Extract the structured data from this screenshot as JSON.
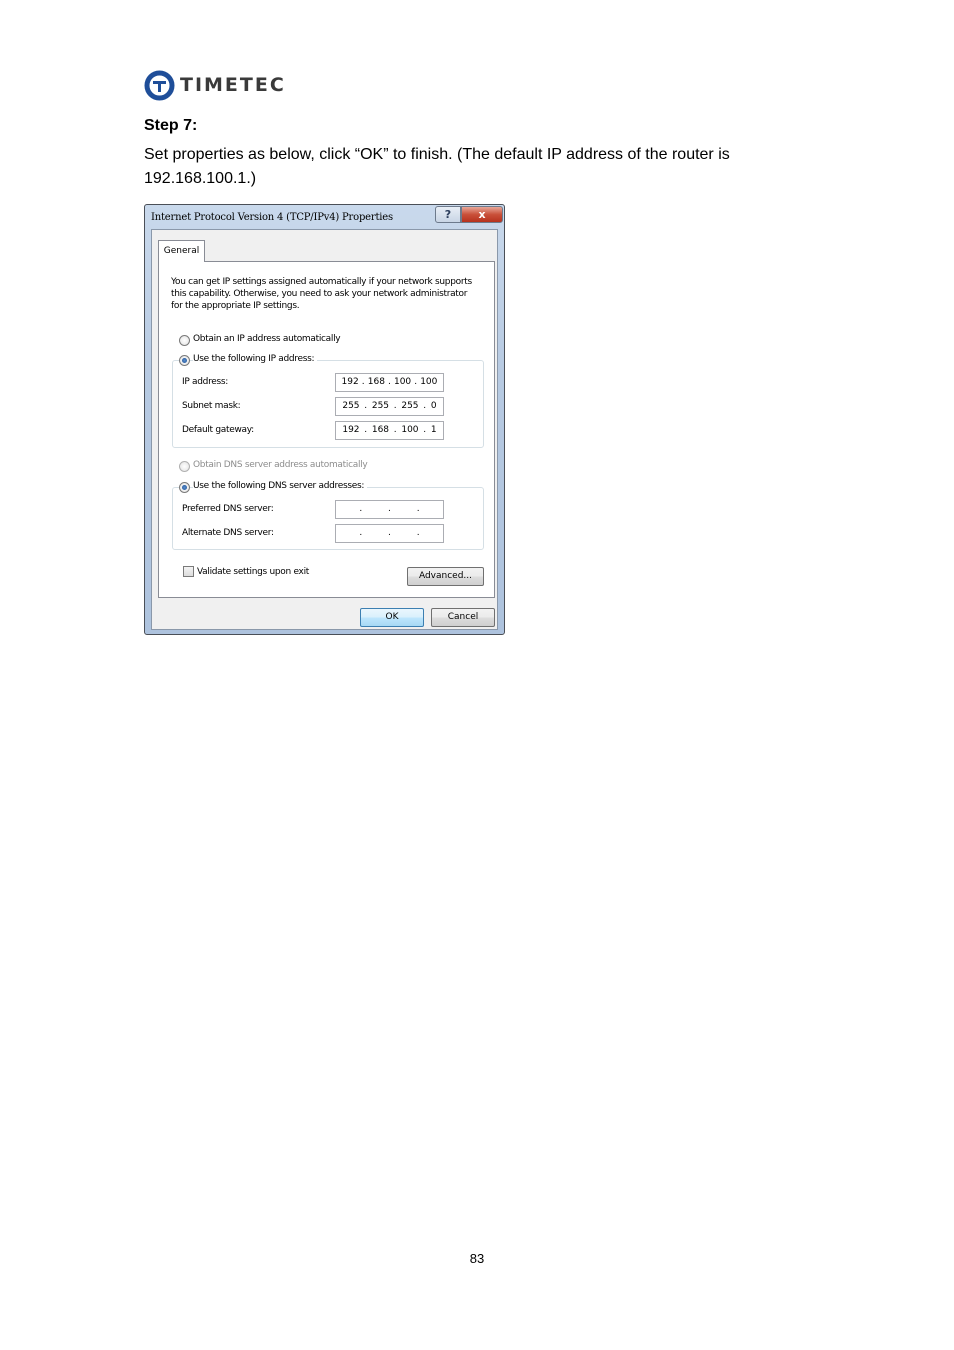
{
  "header": {
    "logo_text": "TIMETEC",
    "step_title": "Step 7:",
    "instruction": "Set properties as below, click “OK” to finish. (The default IP address of the router is 192.168.100.1.)"
  },
  "dialog": {
    "title": "Internet Protocol Version 4 (TCP/IPv4) Properties",
    "help_icon": "?",
    "close_icon": "x",
    "tab_general": "General",
    "intro": "You can get IP settings assigned automatically if your network supports this capability. Otherwise, you need to ask your network administrator for the appropriate IP settings.",
    "radio_auto_ip": "Obtain an IP address automatically",
    "radio_manual_ip": "Use the following IP address:",
    "ip_label": "IP address:",
    "ip_value": [
      "192",
      "168",
      "100",
      "100"
    ],
    "subnet_label": "Subnet mask:",
    "subnet_value": [
      "255",
      "255",
      "255",
      "0"
    ],
    "gateway_label": "Default gateway:",
    "gateway_value": [
      "192",
      "168",
      "100",
      "1"
    ],
    "radio_auto_dns": "Obtain DNS server address automatically",
    "radio_manual_dns": "Use the following DNS server addresses:",
    "preferred_dns_label": "Preferred DNS server:",
    "alternate_dns_label": "Alternate DNS server:",
    "validate_label": "Validate settings upon exit",
    "advanced_button": "Advanced...",
    "ok_button": "OK",
    "cancel_button": "Cancel"
  },
  "footer": {
    "page_number": "83"
  },
  "colors": {
    "logo_blue": "#1f4e99",
    "dialog_frame": "#b7cae2"
  }
}
